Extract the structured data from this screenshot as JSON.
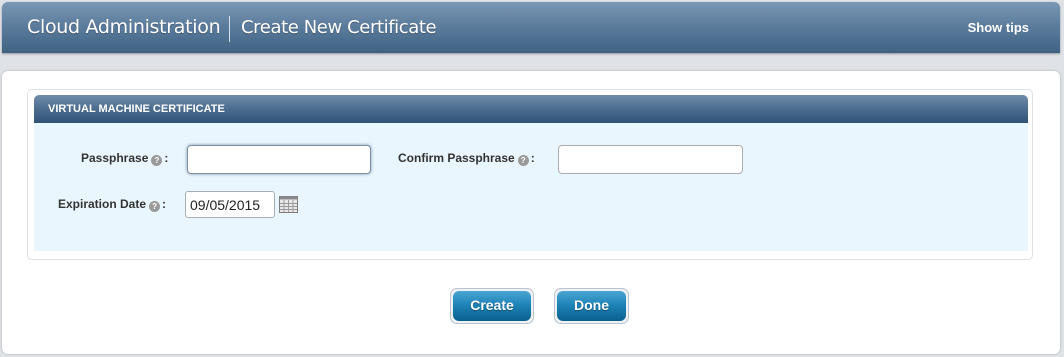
{
  "header": {
    "title": "Cloud Administration",
    "subtitle": "Create New Certificate",
    "show_tips": "Show tips"
  },
  "section": {
    "title": "VIRTUAL MACHINE CERTIFICATE",
    "passphrase": {
      "label": "Passphrase",
      "value": ""
    },
    "confirm_passphrase": {
      "label": "Confirm Passphrase",
      "value": ""
    },
    "expiration_date": {
      "label": "Expiration Date",
      "value": "09/05/2015"
    },
    "help_glyph": "?",
    "colon": ":"
  },
  "actions": {
    "create": "Create",
    "done": "Done"
  },
  "colors": {
    "header": "#5d7d9d",
    "section_header": "#4c6d8f",
    "section_body": "#eaf6fd",
    "button": "#1f84b8"
  },
  "icons": {
    "help": "help-circle-icon",
    "calendar": "calendar-icon"
  }
}
